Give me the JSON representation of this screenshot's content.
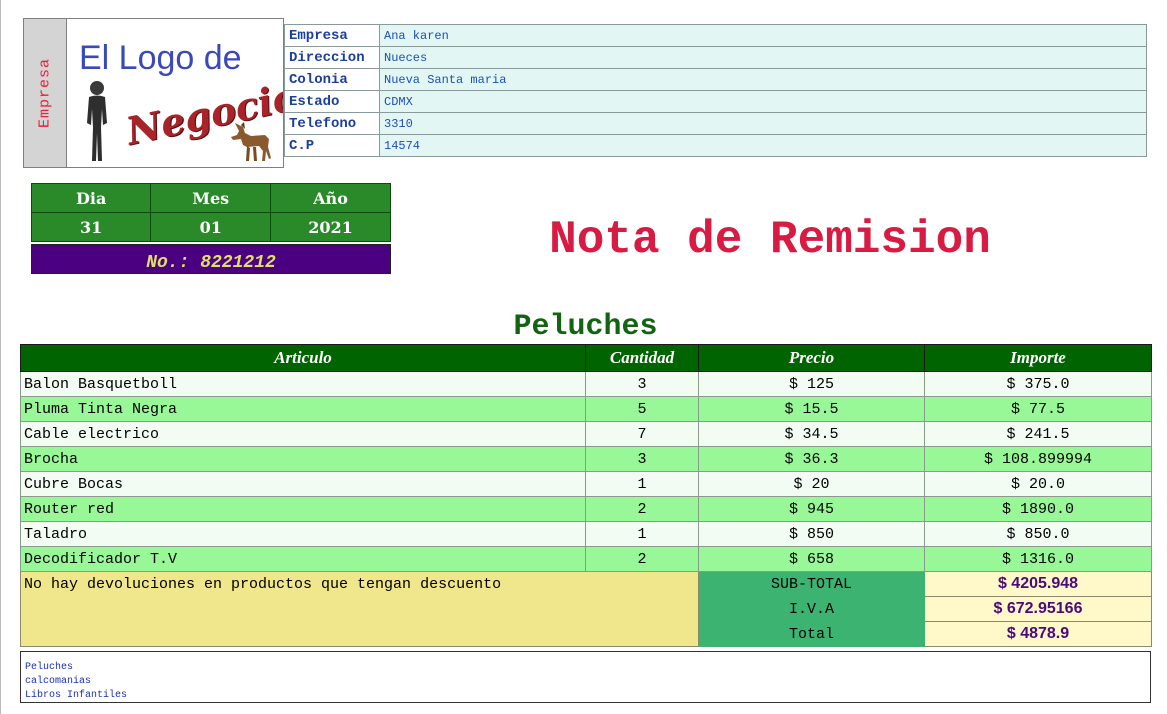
{
  "logo": {
    "side_label": "Empresa",
    "line1": "El Logo de",
    "line2": "Negocio"
  },
  "company_info": [
    {
      "label": "Empresa",
      "value": "Ana karen"
    },
    {
      "label": "Direccion",
      "value": "Nueces"
    },
    {
      "label": "Colonia",
      "value": "Nueva Santa maria"
    },
    {
      "label": "Estado",
      "value": "CDMX"
    },
    {
      "label": "Telefono",
      "value": "3310"
    },
    {
      "label": "C.P",
      "value": "14574"
    }
  ],
  "date": {
    "day_label": "Dia",
    "month_label": "Mes",
    "year_label": "Año",
    "day": "31",
    "month": "01",
    "year": "2021"
  },
  "note_number": "No.: 8221212",
  "title": "Nota de Remision",
  "subtitle": "Peluches",
  "table": {
    "headers": {
      "article": "Articulo",
      "quantity": "Cantidad",
      "price": "Precio",
      "amount": "Importe"
    },
    "rows": [
      {
        "article": "Balon Basquetboll",
        "quantity": "3",
        "price": "$ 125",
        "amount": "$ 375.0"
      },
      {
        "article": "Pluma Tinta Negra",
        "quantity": "5",
        "price": "$ 15.5",
        "amount": "$ 77.5"
      },
      {
        "article": "Cable electrico",
        "quantity": "7",
        "price": "$ 34.5",
        "amount": "$ 241.5"
      },
      {
        "article": "Brocha",
        "quantity": "3",
        "price": "$ 36.3",
        "amount": "$ 108.899994"
      },
      {
        "article": "Cubre Bocas",
        "quantity": "1",
        "price": "$ 20",
        "amount": "$ 20.0"
      },
      {
        "article": "Router red",
        "quantity": "2",
        "price": "$ 945",
        "amount": "$ 1890.0"
      },
      {
        "article": "Taladro",
        "quantity": "1",
        "price": "$ 850",
        "amount": "$ 850.0"
      },
      {
        "article": "Decodificador T.V",
        "quantity": "2",
        "price": "$ 658",
        "amount": "$ 1316.0"
      }
    ],
    "note": "No hay devoluciones en productos que tengan descuento",
    "totals": [
      {
        "label": "SUB-TOTAL",
        "value": "$ 4205.948"
      },
      {
        "label": "I.V.A",
        "value": "$ 672.95166"
      },
      {
        "label": "Total",
        "value": "$ 4878.9"
      }
    ]
  },
  "categories": [
    "Peluches",
    "calcomanias",
    "Libros Infantiles"
  ],
  "colors": {
    "title": "#d81b43",
    "subtitle": "#136313",
    "header_green": "#006400",
    "row_alt_green": "#98f898",
    "note_purple": "#4b0082"
  }
}
